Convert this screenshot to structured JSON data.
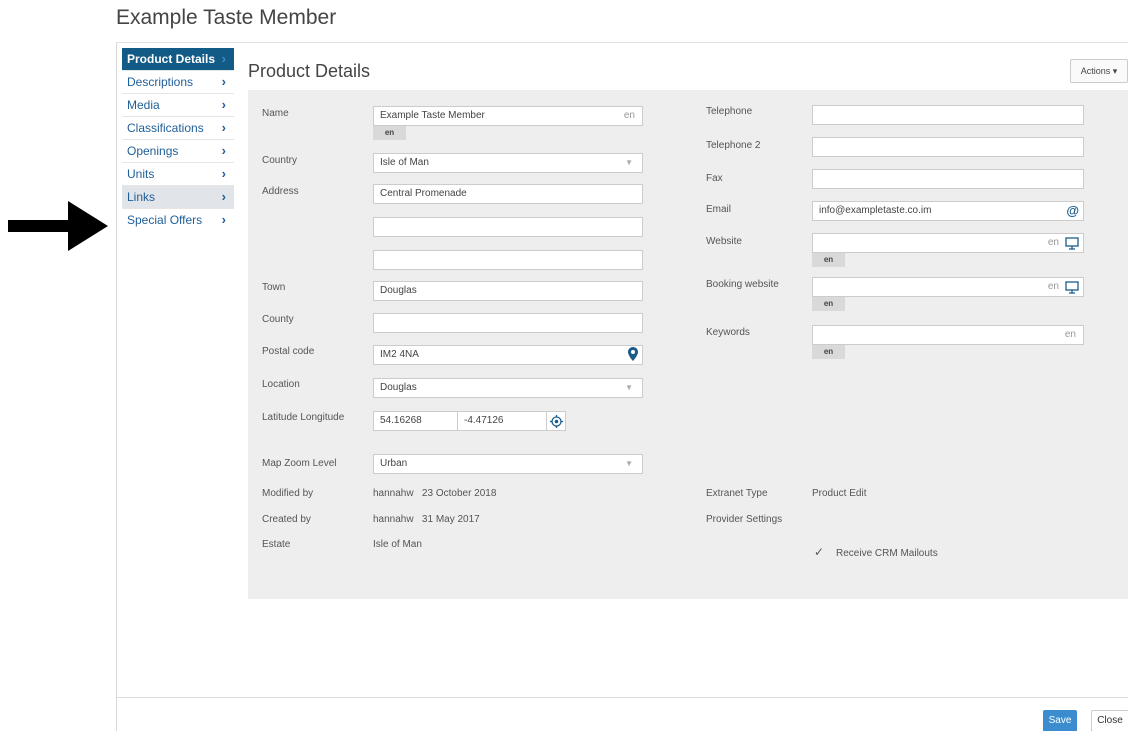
{
  "page": {
    "title": "Example Taste Member"
  },
  "sidebar": {
    "items": [
      {
        "label": "Product Details"
      },
      {
        "label": "Descriptions"
      },
      {
        "label": "Media"
      },
      {
        "label": "Classifications"
      },
      {
        "label": "Openings"
      },
      {
        "label": "Units"
      },
      {
        "label": "Links"
      },
      {
        "label": "Special Offers"
      }
    ],
    "chevron": "›"
  },
  "content": {
    "title": "Product Details",
    "actions_label": "Actions ▾"
  },
  "form": {
    "lang": "en",
    "name": {
      "label": "Name",
      "value": "Example Taste Member"
    },
    "country": {
      "label": "Country",
      "value": "Isle of Man"
    },
    "address": {
      "label": "Address",
      "line1": "Central Promenade",
      "line2": "",
      "line3": ""
    },
    "town": {
      "label": "Town",
      "value": "Douglas"
    },
    "county": {
      "label": "County",
      "value": ""
    },
    "postal_code": {
      "label": "Postal code",
      "value": "IM2 4NA"
    },
    "location": {
      "label": "Location",
      "value": "Douglas"
    },
    "latlong": {
      "label": "Latitude Longitude",
      "latitude": "54.16268",
      "longitude": "-4.47126"
    },
    "map_zoom": {
      "label": "Map Zoom Level",
      "value": "Urban"
    },
    "modified_by": {
      "label": "Modified by",
      "value": "hannahw   23 October 2018"
    },
    "created_by": {
      "label": "Created by",
      "value": "hannahw   31 May 2017"
    },
    "estate": {
      "label": "Estate",
      "value": "Isle of Man"
    },
    "telephone": {
      "label": "Telephone",
      "value": ""
    },
    "telephone2": {
      "label": "Telephone 2",
      "value": ""
    },
    "fax": {
      "label": "Fax",
      "value": ""
    },
    "email": {
      "label": "Email",
      "value": "info@exampletaste.co.im"
    },
    "website": {
      "label": "Website",
      "value": ""
    },
    "booking_website": {
      "label": "Booking website",
      "value": ""
    },
    "keywords": {
      "label": "Keywords",
      "value": ""
    },
    "extranet_type": {
      "label": "Extranet Type",
      "value": "Product Edit"
    },
    "provider_settings": {
      "label": "Provider Settings"
    },
    "crm_mailouts": {
      "label": "Receive CRM Mailouts",
      "checked": true
    }
  },
  "footer": {
    "save_label": "Save",
    "close_label": "Close"
  },
  "colors": {
    "accent": "#135b87",
    "link": "#1f5f99",
    "save": "#3c8dcf",
    "panel": "#eeeeee"
  }
}
